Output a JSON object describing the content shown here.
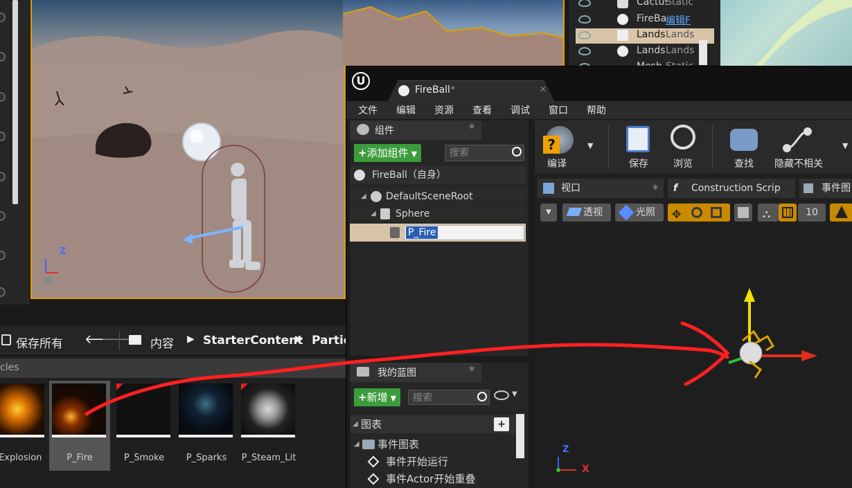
{
  "outliner": {
    "rows": [
      {
        "name": "Cactus",
        "type": "Static"
      },
      {
        "name": "FireBa",
        "type": "编辑F"
      },
      {
        "name": "Lands",
        "type": "Lands"
      },
      {
        "name": "Lands",
        "type": "Lands"
      },
      {
        "name": "Mesh",
        "type": "Static"
      }
    ]
  },
  "content_browser": {
    "save_all": "保存所有",
    "path": [
      "内容",
      "StarterContent",
      "Partic"
    ],
    "filter_tab": "cles",
    "assets": [
      {
        "name": "_Explosion"
      },
      {
        "name": "P_Fire"
      },
      {
        "name": "P_Smoke"
      },
      {
        "name": "P_Sparks"
      },
      {
        "name": "P_Steam_Lit"
      }
    ]
  },
  "blueprint_editor": {
    "tab_title": "FireBall",
    "tab_dirty": "*",
    "menu": [
      "文件",
      "编辑",
      "资源",
      "查看",
      "调试",
      "窗口",
      "帮助"
    ],
    "components": {
      "header": "组件",
      "add_button": "添加组件",
      "search_placeholder": "搜索",
      "self_label": "FireBall（自身）",
      "tree": [
        "DefaultSceneRoot",
        "Sphere",
        "P_Fire"
      ]
    },
    "my_blueprint": {
      "header": "我的蓝图",
      "new_button": "新增",
      "search_placeholder": "搜索",
      "section_graphs": "图表",
      "event_graph": "事件图表",
      "events": [
        "事件开始运行",
        "事件Actor开始重叠"
      ]
    },
    "toolbar": {
      "compile": "编译",
      "save": "保存",
      "browse": "浏览",
      "find": "查找",
      "hide_unrelated": "隐藏不相关"
    },
    "viewport_tabs": [
      "视口",
      "Construction Scrip",
      "事件图"
    ],
    "viewport_buttons": {
      "perspective": "透视",
      "lit": "光照",
      "grid_snap": "10"
    },
    "axes": {
      "z": "Z",
      "x": "X"
    }
  },
  "main_viewport_axes": {
    "z": "Z"
  },
  "colors": {
    "accent_orange": "#e0a000",
    "green_button": "#3c9c3c",
    "selected_row": "#d9c4a8",
    "annotation_red": "#ff2020"
  }
}
